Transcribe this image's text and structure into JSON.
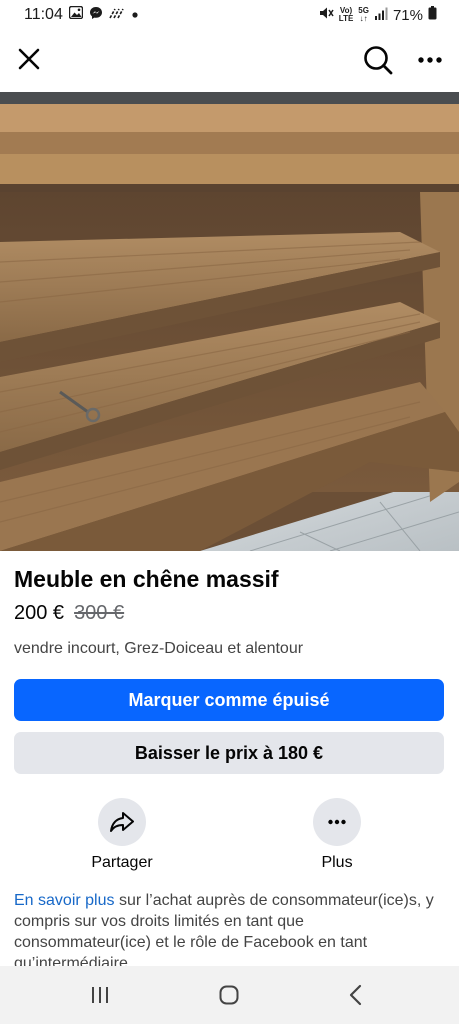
{
  "status_bar": {
    "time": "11:04",
    "battery": "71%",
    "volte_label": "Vo)\nLTE",
    "network_label": "5G"
  },
  "top_bar": {
    "close_icon": "close-icon",
    "search_icon": "search-icon",
    "more_icon": "more-horizontal-icon"
  },
  "photo": {
    "subject": "wooden oak cabinet with shelves",
    "pager_dots": 3,
    "active_dot": 2
  },
  "listing": {
    "title": "Meuble en chêne massif",
    "price": "200 €",
    "old_price": "300 €",
    "location": "vendre incourt, Grez-Doiceau et alentour"
  },
  "buttons": {
    "mark_sold": "Marquer comme épuisé",
    "lower_price": "Baisser le prix à 180 €"
  },
  "actions": [
    {
      "label": "Partager",
      "icon": "share-icon"
    },
    {
      "label": "Plus",
      "icon": "more-horizontal-icon"
    }
  ],
  "info": {
    "link_text": "En savoir plus",
    "text": " sur l’achat auprès de consommateur(ice)s, y compris sur vos droits limités en tant que consommateur(ice) et le rôle de Facebook en tant qu’intermédiaire."
  },
  "colors": {
    "primary": "#0866ff",
    "secondary_bg": "#e4e6eb",
    "link": "#1768c8"
  }
}
